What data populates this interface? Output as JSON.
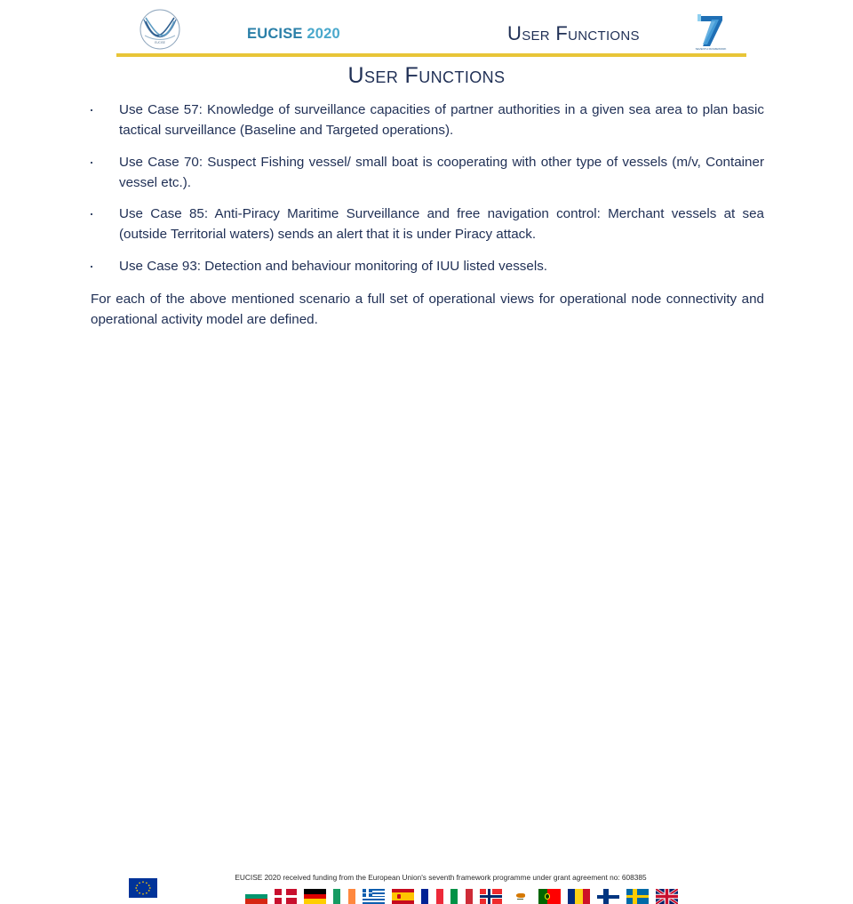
{
  "header": {
    "brand_primary": "EUCISE",
    "brand_secondary": " 2020",
    "title": "User Functions",
    "logo_icon": "eucise-circular-logo",
    "fp7_icon": "fp7-seventh-framework-programme-logo",
    "rule_color": "#e8c537",
    "brand_color_primary": "#2a7fa8",
    "brand_color_secondary": "#49a8cc"
  },
  "slide": {
    "title": "User Functions",
    "title_color": "#1f2f55",
    "body_color": "#1f2f55",
    "bullets": [
      "Use Case 57: Knowledge of surveillance capacities of partner authorities in a given sea area to plan basic tactical surveillance (Baseline and Targeted operations).",
      "Use Case 70: Suspect Fishing vessel/ small boat is cooperating with other type of vessels (m/v, Container vessel etc.).",
      "Use Case 85: Anti-Piracy Maritime Surveillance and free navigation control: Merchant vessels at sea (outside Territorial waters) sends an alert that it is under Piracy attack.",
      "Use Case 93: Detection and behaviour monitoring of IUU listed vessels."
    ],
    "closing_paragraph": "For each of the above mentioned scenario a full set of operational views for operational node connectivity and operational activity model are defined."
  },
  "footer": {
    "eu_flag_name": "european-union-flag",
    "note": "EUCISE 2020 received funding from the European Union's seventh framework programme under grant agreement no: 608385",
    "flags": [
      "bulgaria-flag",
      "denmark-flag",
      "germany-flag",
      "ireland-flag",
      "greece-flag",
      "spain-flag",
      "france-flag",
      "italy-flag",
      "norway-flag",
      "cyprus-flag",
      "portugal-flag",
      "romania-flag",
      "finland-flag",
      "sweden-flag",
      "united-kingdom-flag"
    ]
  }
}
